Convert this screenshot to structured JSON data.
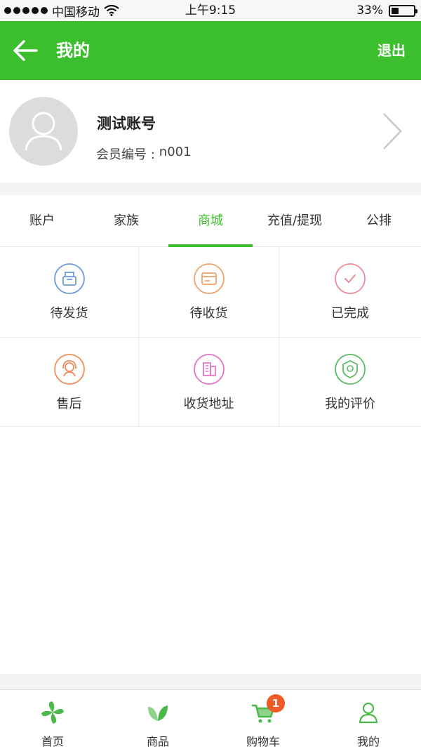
{
  "status_bar": {
    "carrier": "中国移动",
    "time": "上午9:15",
    "battery": "33%",
    "battery_level": 0.33
  },
  "nav": {
    "title": "我的",
    "logout": "退出",
    "back_icon": "arrow-left-icon"
  },
  "profile": {
    "name": "测试账号",
    "member_label": "会员编号 :",
    "member_id": "n001",
    "avatar_icon": "user-avatar-icon",
    "arrow_icon": "chevron-right-icon"
  },
  "tabs": [
    {
      "label": "账户",
      "active": false
    },
    {
      "label": "家族",
      "active": false
    },
    {
      "label": "商城",
      "active": true
    },
    {
      "label": "充值/提现",
      "active": false
    },
    {
      "label": "公排",
      "active": false
    }
  ],
  "grid_items": [
    {
      "label": "待发货",
      "icon": "package-icon",
      "color": "#6b9bd8"
    },
    {
      "label": "待收货",
      "icon": "wallet-icon",
      "color": "#f0a26a"
    },
    {
      "label": "已完成",
      "icon": "check-icon",
      "color": "#ef8a9a"
    },
    {
      "label": "售后",
      "icon": "service-agent-icon",
      "color": "#f28c5a"
    },
    {
      "label": "收货地址",
      "icon": "building-icon",
      "color": "#e874c8"
    },
    {
      "label": "我的评价",
      "icon": "badge-star-icon",
      "color": "#5dbb63"
    }
  ],
  "bottom_nav": [
    {
      "label": "首页",
      "icon": "pinwheel-icon"
    },
    {
      "label": "商品",
      "icon": "leaf-icon"
    },
    {
      "label": "购物车",
      "icon": "cart-icon",
      "badge": "1"
    },
    {
      "label": "我的",
      "icon": "user-icon"
    }
  ],
  "colors": {
    "accent": "#3cbf2e",
    "badge": "#f05a24"
  }
}
